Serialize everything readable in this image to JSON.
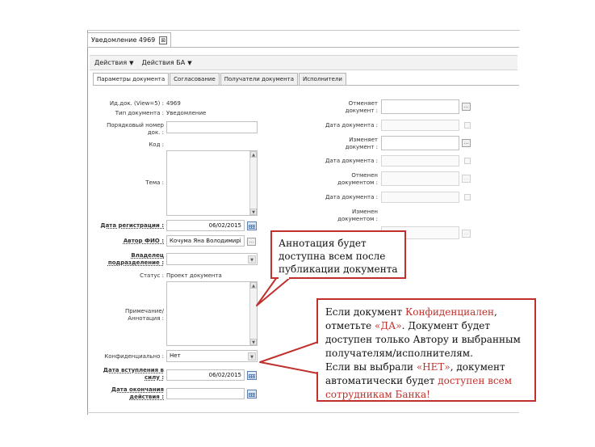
{
  "window": {
    "tab_title": "Уведомление 4969",
    "close_symbol": "⊠"
  },
  "toolbar": {
    "actions_label": "Действия",
    "ba_actions_label": "Действия БА",
    "caret": "▼"
  },
  "tabs": [
    "Параметры документа",
    "Согласование",
    "Получатели документа",
    "Исполнители"
  ],
  "left_form": {
    "id_label": "Ид.док. (View=5) :",
    "id_value": "4969",
    "type_label": "Тип документа :",
    "type_value": "Уведомление",
    "ordinal_label_1": "Порядковый номер",
    "ordinal_label_2": "док. :",
    "code_label": "Код :",
    "subject_label": "Тема :",
    "reg_date_label": "Дата регистрации :",
    "reg_date_value": "06/02/2015",
    "author_label": "Автор ФИО :",
    "author_value": "Кочума Яна Володимирі",
    "owner_label_1": "Владелец",
    "owner_label_2": "подразделение :",
    "status_label": "Статус :",
    "status_value": "Проект документа",
    "note_label_1": "Примечание/",
    "note_label_2": "Аннотация :",
    "conf_label": "Конфиденциально :",
    "conf_value": "Нет",
    "start_date_label_1": "Дата вступления в",
    "start_date_label_2": "силу :",
    "start_date_value": "06/02/2015",
    "end_date_label_1": "Дата окончания",
    "end_date_label_2": "действия :"
  },
  "right_form": {
    "cancels_label_1": "Отменяет",
    "cancels_label_2": "документ :",
    "date1_label": "Дата документа :",
    "changes_label_1": "Изменяет",
    "changes_label_2": "документ :",
    "date2_label": "Дата документа :",
    "canceled_label_1": "Отменен",
    "canceled_label_2": "документом :",
    "date3_label": "Дата документа :",
    "changed_label_1": "Изменен",
    "changed_label_2": "документом :",
    "dots": "..."
  },
  "callout_annotation": "Аннотация будет доступна всем после публикации документа",
  "callout_conf": {
    "p1a": "Если документ ",
    "p1b": "Конфиденциален",
    "p1c": ",",
    "p2a": "отметьте ",
    "p2b": "«ДА»",
    "p2c": ". Документ будет",
    "p3": "доступен только Автору и выбранным",
    "p4": "получателям/исполнителям.",
    "p5a": "Если вы выбрали ",
    "p5b": "«НЕТ»",
    "p5c": ", документ",
    "p6a": "автоматически будет ",
    "p6b": "доступен всем",
    "p7": "сотрудникам Банка!"
  },
  "colors": {
    "accent_red": "#c0312c",
    "calendar_blue": "#5b7fb1"
  }
}
